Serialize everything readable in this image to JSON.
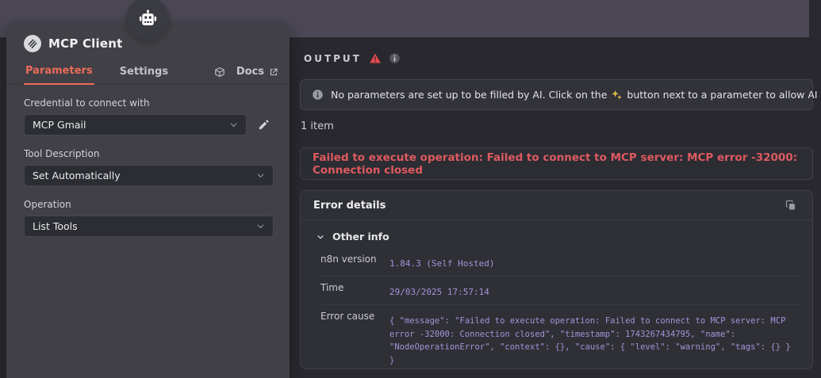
{
  "node": {
    "title": "MCP Client",
    "tabs": {
      "parameters": "Parameters",
      "settings": "Settings"
    },
    "docs_label": "Docs",
    "parameters": {
      "credential": {
        "label": "Credential to connect with",
        "value": "MCP Gmail"
      },
      "tool_description": {
        "label": "Tool Description",
        "value": "Set Automatically"
      },
      "operation": {
        "label": "Operation",
        "value": "List Tools"
      }
    }
  },
  "output": {
    "title": "OUTPUT",
    "banner": {
      "text_before": "No parameters are set up to be filled by AI. Click on the",
      "text_after": "button next to a parameter to allow AI to set its value."
    },
    "items_count": "1 item",
    "error_message": "Failed to execute operation: Failed to connect to MCP server: MCP error -32000: Connection closed",
    "error_details": {
      "title": "Error details",
      "section_label": "Other info",
      "rows": [
        {
          "label": "n8n version",
          "value": "1.84.3 (Self Hosted)"
        },
        {
          "label": "Time",
          "value": "29/03/2025 17:57:14"
        },
        {
          "label": "Error cause",
          "value": "{ \"message\": \"Failed to execute operation: Failed to connect to MCP server: MCP error -32000: Connection closed\", \"timestamp\": 1743267434795, \"name\": \"NodeOperationError\", \"context\": {}, \"cause\": { \"level\": \"warning\", \"tags\": {} } }"
        }
      ]
    }
  },
  "colors": {
    "accent_orange": "#ed6a5a",
    "error_red": "#dd5a60",
    "warning_triangle": "#e5484d",
    "mono_value_purple": "#a493d8",
    "sparkle_yellow": "#e7c24a",
    "topbar_purple": "#4b4754",
    "panel_gray": "#404046"
  }
}
